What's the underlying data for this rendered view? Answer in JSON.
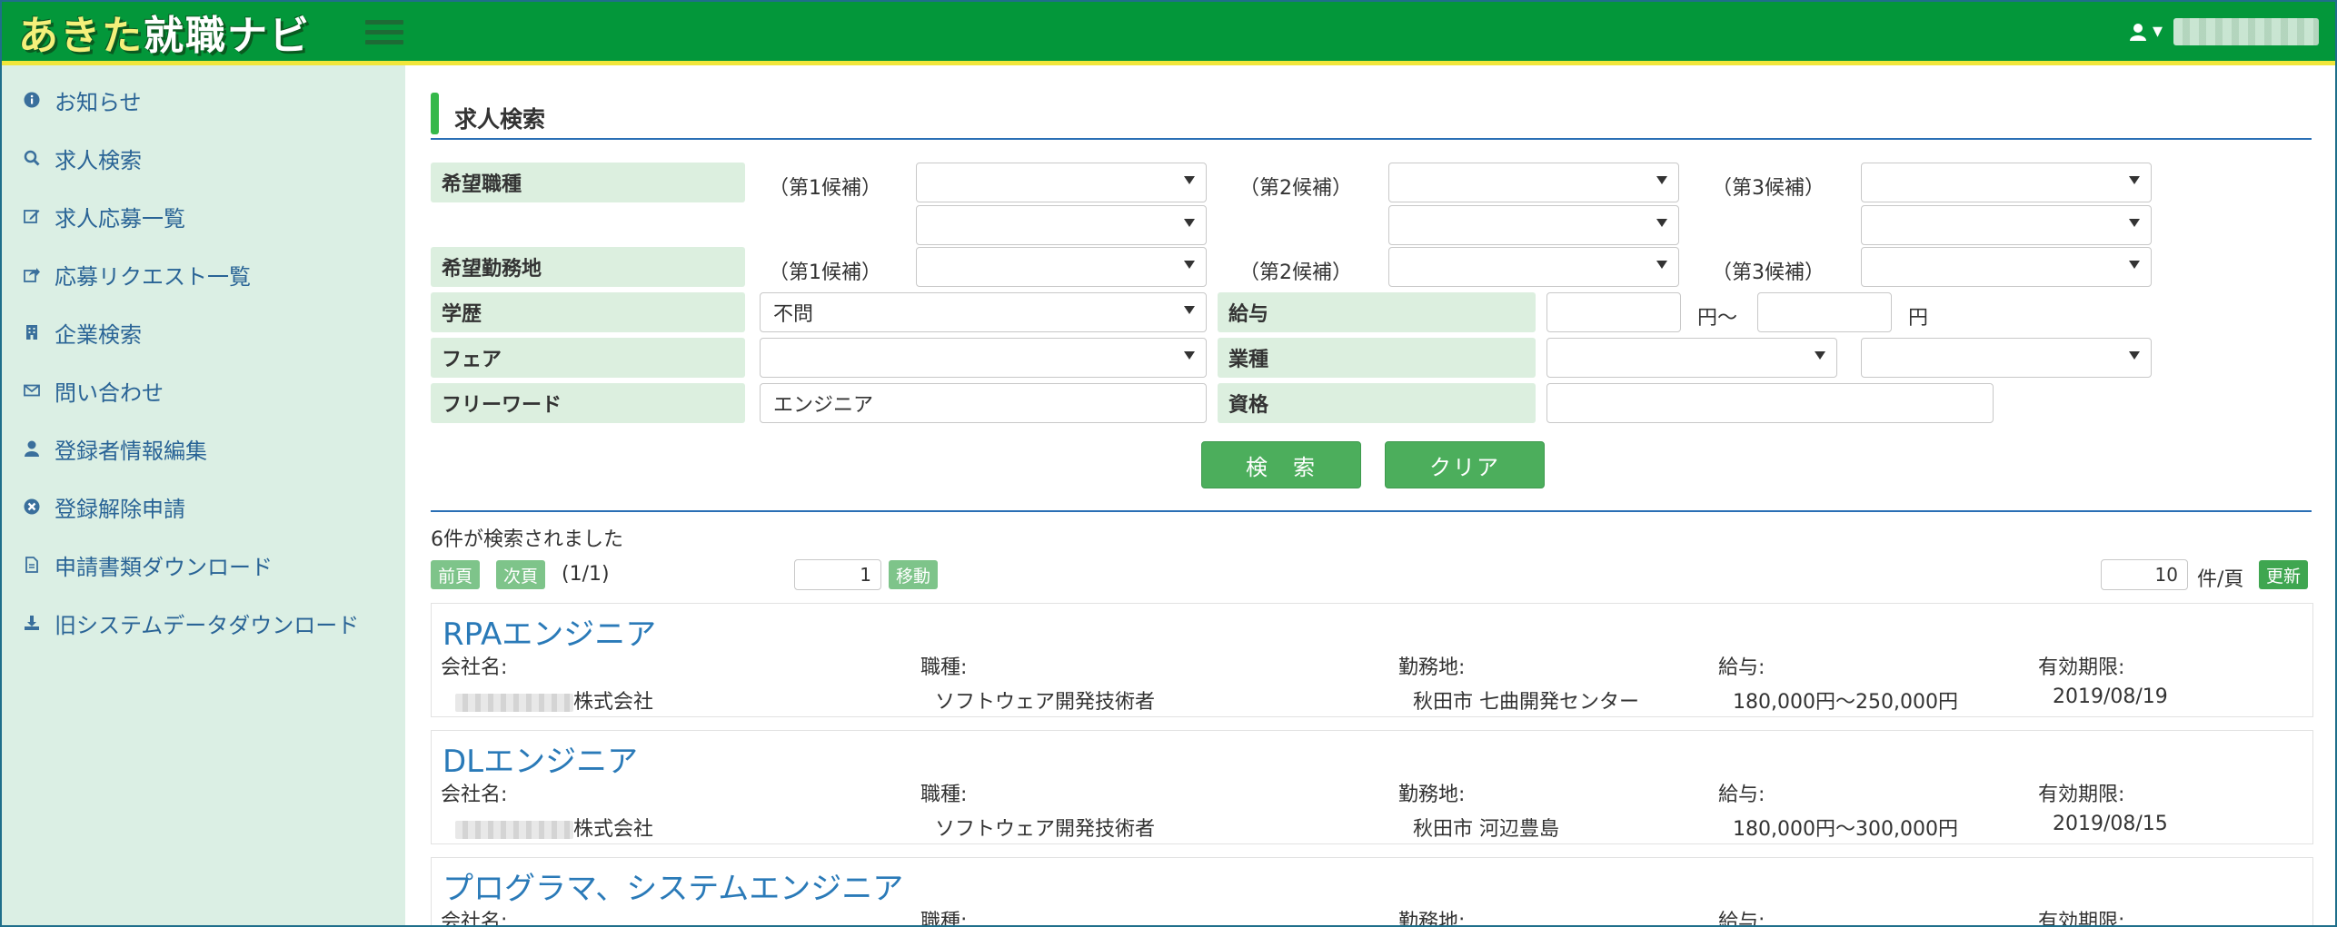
{
  "app": {
    "logo_part1": "あきた",
    "logo_part2": "就職ナビ",
    "user_menu_caret": "▾"
  },
  "sidebar": {
    "items": [
      {
        "label": "お知らせ",
        "icon": "info-circle-icon"
      },
      {
        "label": "求人検索",
        "icon": "search-icon"
      },
      {
        "label": "求人応募一覧",
        "icon": "edit-icon"
      },
      {
        "label": "応募リクエスト一覧",
        "icon": "share-icon"
      },
      {
        "label": "企業検索",
        "icon": "building-icon"
      },
      {
        "label": "問い合わせ",
        "icon": "envelope-icon"
      },
      {
        "label": "登録者情報編集",
        "icon": "user-icon"
      },
      {
        "label": "登録解除申請",
        "icon": "times-circle-icon"
      },
      {
        "label": "申請書類ダウンロード",
        "icon": "file-icon"
      },
      {
        "label": "旧システムデータダウンロード",
        "icon": "download-icon"
      }
    ]
  },
  "page": {
    "title": "求人検索"
  },
  "form": {
    "job_type_label": "希望職種",
    "location_label": "希望勤務地",
    "cand1": "（第1候補）",
    "cand2": "（第2候補）",
    "cand3": "（第3候補）",
    "education_label": "学歴",
    "education_value": "不問",
    "salary_label": "給与",
    "salary_unit_from": "円～",
    "salary_unit_to": "円",
    "fair_label": "フェア",
    "industry_label": "業種",
    "freeword_label": "フリーワード",
    "freeword_value": "エンジニア",
    "qualification_label": "資格",
    "search_button": "検　索",
    "clear_button": "クリア"
  },
  "results": {
    "count_text": "6件が検索されました",
    "prev_label": "前頁",
    "next_label": "次頁",
    "page_indicator": "(1/1)",
    "page_input": "1",
    "go_label": "移動",
    "per_page_value": "10",
    "per_page_unit": "件/頁",
    "refresh_label": "更新",
    "field_labels": {
      "company": "会社名:",
      "job": "職種:",
      "location": "勤務地:",
      "salary": "給与:",
      "expiry": "有効期限:"
    },
    "items": [
      {
        "title": "RPAエンジニア",
        "company_suffix": "株式会社",
        "job": "ソフトウェア開発技術者",
        "location": "秋田市 七曲開発センター",
        "salary": "180,000円～250,000円",
        "expiry": "2019/08/19"
      },
      {
        "title": "DLエンジニア",
        "company_suffix": "株式会社",
        "job": "ソフトウェア開発技術者",
        "location": "秋田市 河辺豊島",
        "salary": "180,000円～300,000円",
        "expiry": "2019/08/15"
      },
      {
        "title": "プログラマ、システムエンジニア",
        "company_suffix": "",
        "job": "",
        "location": "",
        "salary": "",
        "expiry": ""
      }
    ]
  }
}
